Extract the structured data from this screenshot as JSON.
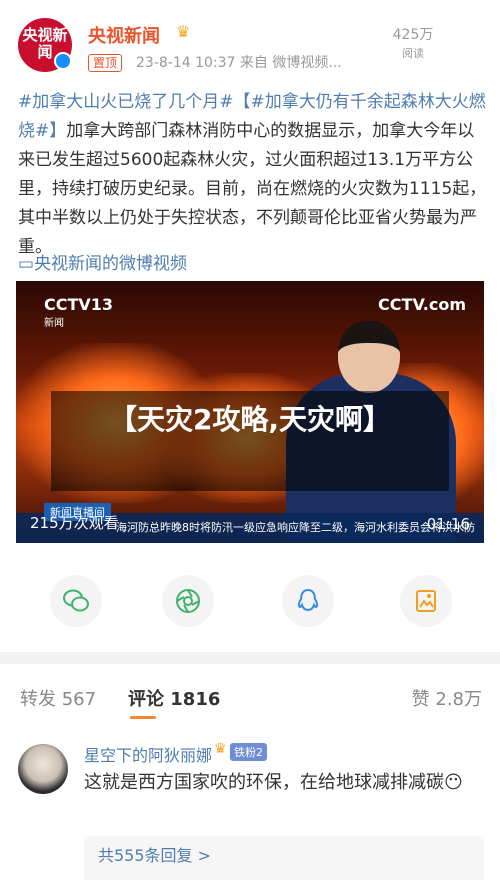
{
  "header": {
    "avatar_text": "央视新闻",
    "account_name": "央视新闻",
    "pinned_label": "置顶",
    "meta": "23-8-14 10:37  来自 微博视频...",
    "views": "425万",
    "views_label": "阅读"
  },
  "post": {
    "tag1": "#加拿大山火已烧了几个月#",
    "tag2": "【#加拿大仍有千余起森林大火燃烧#】",
    "body": "加拿大跨部门森林消防中心的数据显示，加拿大今年以来已发生超过5600起森林火灾，过火面积超过13.1万平方公里，持续打破历史纪录。目前，尚在燃烧的火灾数为1115起，其中半数以上仍处于失控状态，不列颠哥伦比亚省火势最为严重。",
    "source_link": "央视新闻的微博视频"
  },
  "video": {
    "logo_left": "CCTV13",
    "logo_left_sub": "新闻",
    "logo_right": "CCTV.com",
    "ticker_badge": "新闻直播间",
    "ticker_text": "海河防总昨晚8时将防汛一级应急响应降至二级，海河水利委员会将洪水防",
    "overlay_title": "【天灾2攻略,天灾啊】",
    "view_count": "215万次观看",
    "duration": "01:16"
  },
  "share_icons": [
    "wechat-icon",
    "moments-icon",
    "qq-icon",
    "save-image-icon"
  ],
  "tabs": {
    "repost": "转发 567",
    "comment": "评论 1816",
    "like": "赞 2.8万"
  },
  "comment": {
    "user": "星空下的阿狄丽娜",
    "badge": "铁粉2",
    "text": "这就是西方国家吹的环保，在给地球减排减碳😶",
    "replies": "共555条回复 >"
  },
  "colors": {
    "link": "#507daf",
    "accent_orange": "#e8542c",
    "tab_underline": "#f7882f"
  }
}
